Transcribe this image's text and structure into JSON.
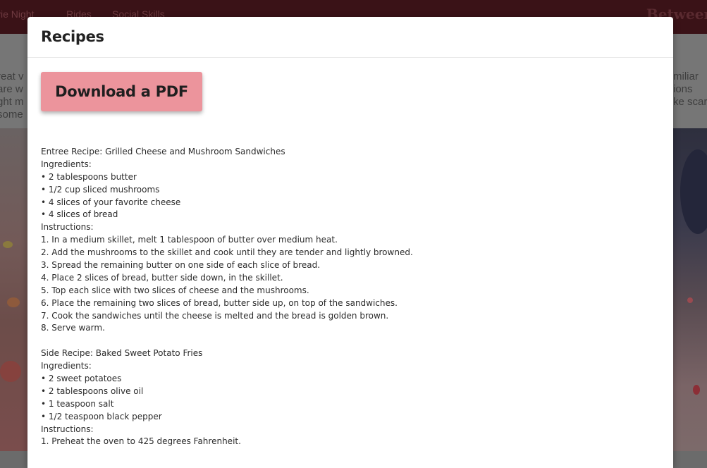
{
  "background": {
    "nav_links": [
      "vie Night",
      "Rides",
      "Social Skills"
    ],
    "brand": "Between",
    "left_text": [
      "reat v",
      "are w",
      "ght m",
      "some"
    ],
    "right_text": [
      "miliar",
      "ions",
      "ke scar"
    ]
  },
  "modal": {
    "title": "Recipes",
    "download_label": "Download a PDF",
    "entree": {
      "title": "Entree Recipe: Grilled Cheese and Mushroom Sandwiches",
      "ingredients_heading": "Ingredients:",
      "ingredients": [
        "• 2 tablespoons butter",
        "• 1/2 cup sliced mushrooms",
        "• 4 slices of your favorite cheese",
        "• 4 slices of bread"
      ],
      "instructions_heading": "Instructions:",
      "instructions": [
        "1. In a medium skillet, melt 1 tablespoon of butter over medium heat.",
        "2. Add the mushrooms to the skillet and cook until they are tender and lightly browned.",
        "3. Spread the remaining butter on one side of each slice of bread.",
        "4. Place 2 slices of bread, butter side down, in the skillet.",
        "5. Top each slice with two slices of cheese and the mushrooms.",
        "6. Place the remaining two slices of bread, butter side up, on top of the sandwiches.",
        "7. Cook the sandwiches until the cheese is melted and the bread is golden brown.",
        "8. Serve warm."
      ]
    },
    "side": {
      "title": "Side Recipe: Baked Sweet Potato Fries",
      "ingredients_heading": "Ingredients:",
      "ingredients": [
        "• 2 sweet potatoes",
        "• 2 tablespoons olive oil",
        "• 1 teaspoon salt",
        "• 1/2 teaspoon black pepper"
      ],
      "instructions_heading": "Instructions:",
      "instructions": [
        "1. Preheat the oven to 425 degrees Fahrenheit."
      ]
    }
  },
  "colors": {
    "download_button": "#ec949c",
    "nav_background": "#3a1217",
    "overlay": "#6b6b6b"
  }
}
